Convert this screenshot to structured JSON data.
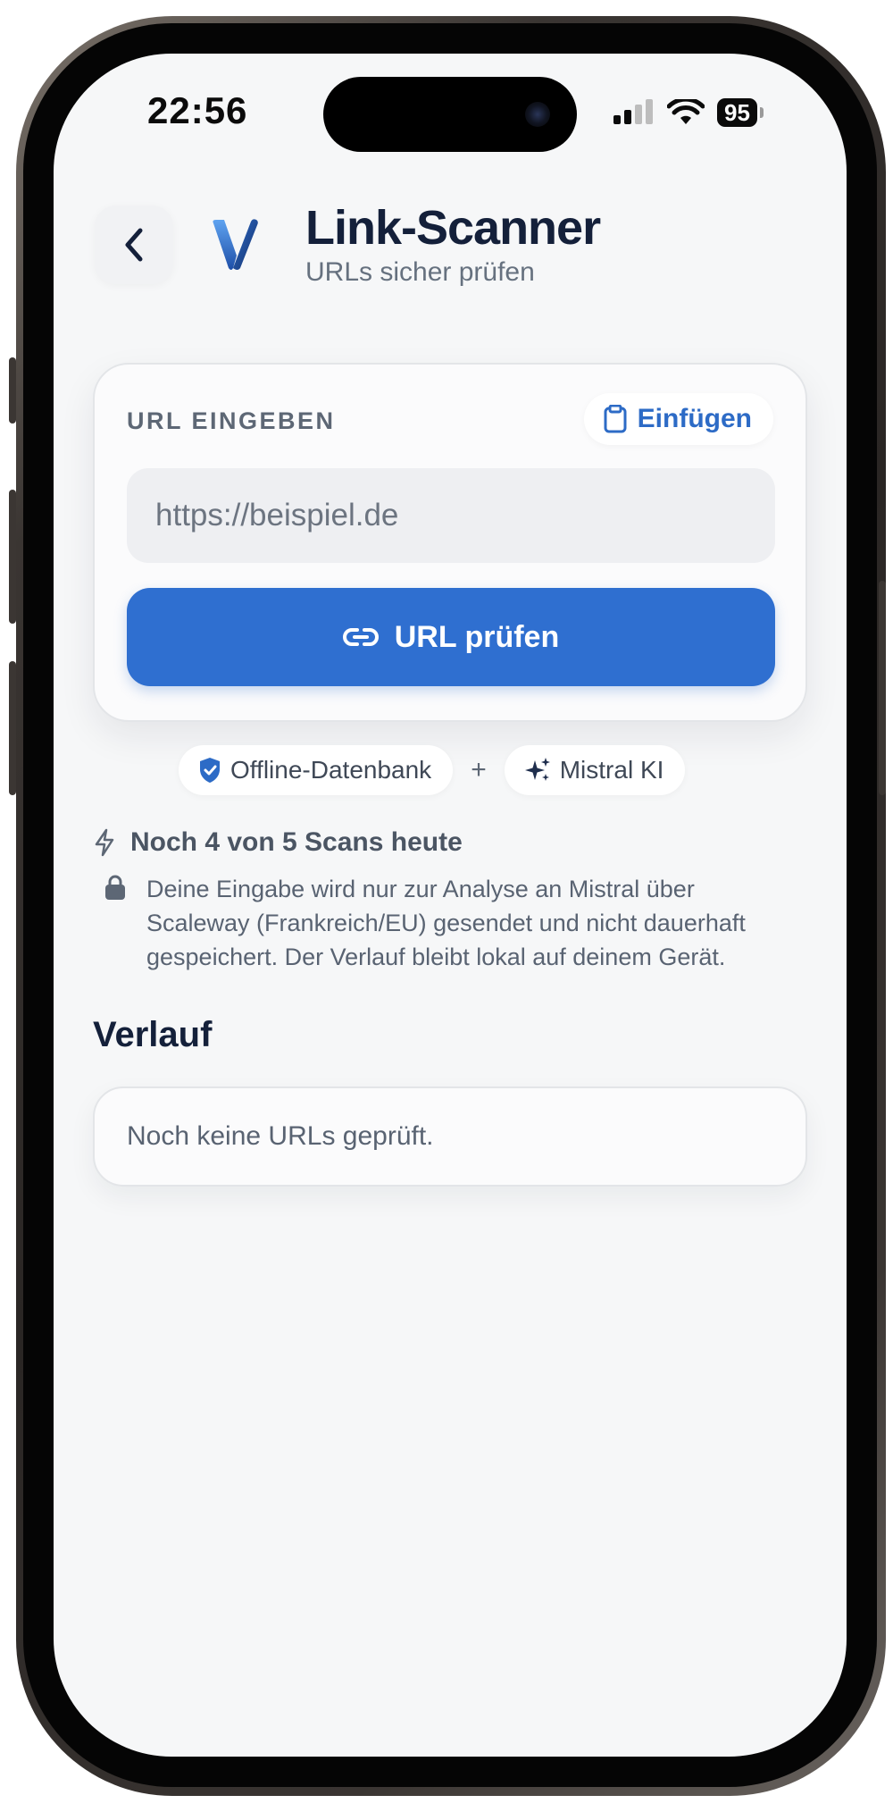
{
  "status_bar": {
    "time": "22:56",
    "battery": "95"
  },
  "header": {
    "title": "Link-Scanner",
    "subtitle": "URLs sicher prüfen"
  },
  "url_card": {
    "label": "URL EINGEBEN",
    "paste_label": "Einfügen",
    "input_placeholder": "https://beispiel.de",
    "input_value": "",
    "submit_label": "URL prüfen"
  },
  "sources": {
    "chip_1": "Offline-Datenbank",
    "separator": "+",
    "chip_2": "Mistral KI"
  },
  "quota": {
    "text": "Noch 4 von 5 Scans heute"
  },
  "privacy": {
    "text": "Deine Eingabe wird nur zur Analyse an Mistral über Scaleway (Frankreich/EU) gesendet und nicht dauerhaft gespeichert. Der Verlauf bleibt lokal auf deinem Gerät."
  },
  "history": {
    "title": "Verlauf",
    "empty_text": "Noch keine URLs geprüft."
  },
  "colors": {
    "accent": "#2f6fd0",
    "title": "#14203a",
    "background": "#f6f7f8"
  },
  "icons": {
    "back": "chevron-left-icon",
    "logo": "v-logo-icon",
    "paste": "clipboard-icon",
    "submit": "link-icon",
    "offline": "shield-check-icon",
    "ai": "sparkles-icon",
    "quota": "bolt-icon",
    "privacy": "lock-icon"
  }
}
